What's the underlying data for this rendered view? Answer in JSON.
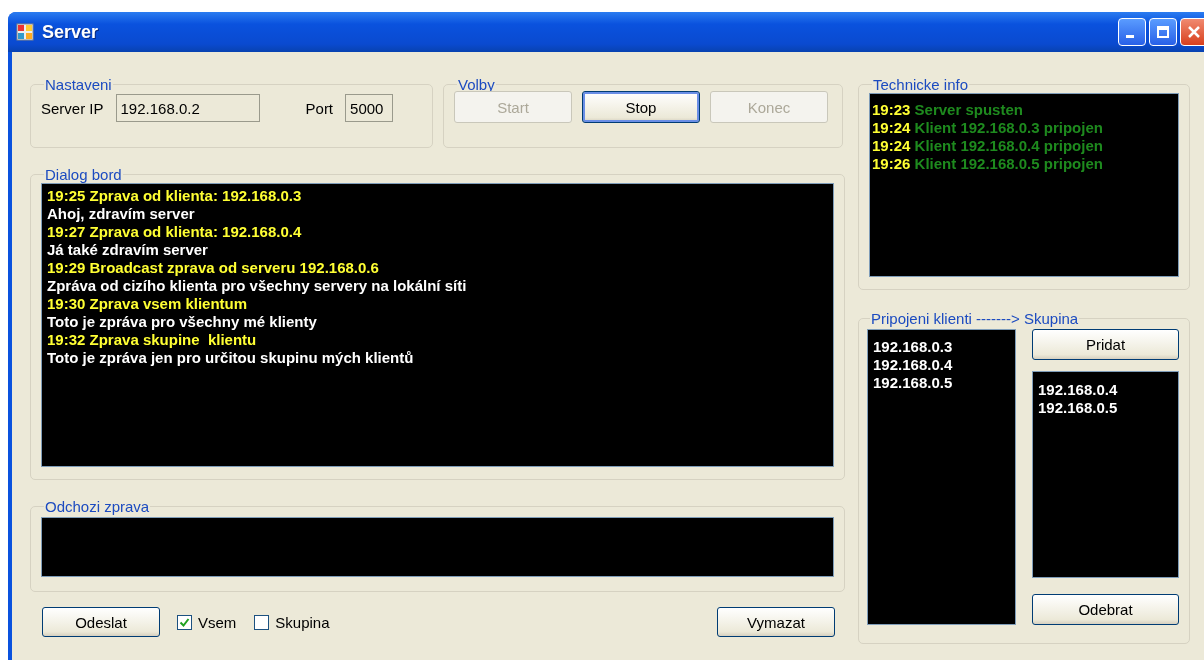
{
  "window": {
    "title": "Server"
  },
  "nastaveni": {
    "legend": "Nastaveni",
    "ip_label": "Server IP",
    "ip_value": "192.168.0.2",
    "port_label": "Port",
    "port_value": "5000"
  },
  "volby": {
    "legend": "Volby",
    "buttons": [
      {
        "label": "Start",
        "disabled": true,
        "focused": false
      },
      {
        "label": "Stop",
        "disabled": false,
        "focused": true
      },
      {
        "label": "Konec",
        "disabled": true,
        "focused": false
      }
    ]
  },
  "dialog": {
    "legend": "Dialog bord",
    "messages": [
      {
        "kind": "header",
        "text": "19:25 Zprava od klienta: 192.168.0.3"
      },
      {
        "kind": "body",
        "text": "Ahoj, zdravím server"
      },
      {
        "kind": "header",
        "text": "19:27 Zprava od klienta: 192.168.0.4"
      },
      {
        "kind": "body",
        "text": "Já také zdravím server"
      },
      {
        "kind": "header",
        "text": "19:29 Broadcast zprava od serveru 192.168.0.6"
      },
      {
        "kind": "body",
        "text": "Zpráva od cizího klienta pro všechny servery na lokální síti"
      },
      {
        "kind": "header",
        "text": "19:30 Zprava vsem klientum"
      },
      {
        "kind": "body",
        "text": "Toto je zpráva pro všechny mé klienty"
      },
      {
        "kind": "header",
        "text": "19:32 Zprava skupine  klientu"
      },
      {
        "kind": "body",
        "text": "Toto je zpráva jen pro určitou skupinu mých klientů"
      }
    ]
  },
  "outgoing": {
    "legend": "Odchozi zprava"
  },
  "bottom": {
    "send": "Odeslat",
    "checkboxes": [
      {
        "label": "Vsem",
        "checked": true
      },
      {
        "label": "Skupina",
        "checked": false
      }
    ],
    "clear": "Vymazat"
  },
  "tech_info": {
    "legend": "Technicke info",
    "entries": [
      {
        "time": "19:23",
        "text": "Server spusten"
      },
      {
        "time": "19:24",
        "text": "Klient 192.168.0.3 pripojen"
      },
      {
        "time": "19:24",
        "text": "Klient 192.168.0.4 pripojen"
      },
      {
        "time": "19:26",
        "text": "Klient 192.168.0.5 pripojen"
      }
    ]
  },
  "clients": {
    "legend": "Pripojeni klienti -------> Skupina",
    "connected": [
      "192.168.0.3",
      "192.168.0.4",
      "192.168.0.5"
    ],
    "add": "Pridat",
    "group": [
      "192.168.0.4",
      "192.168.0.5"
    ],
    "remove": "Odebrat"
  }
}
